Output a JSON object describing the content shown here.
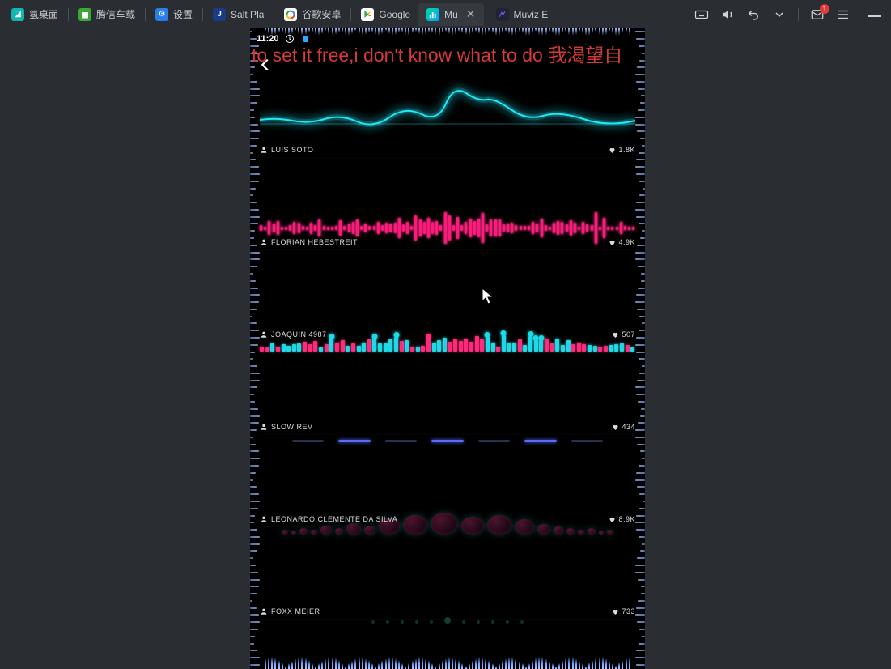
{
  "tabs": [
    {
      "label": "氢桌面",
      "iconClass": "teal"
    },
    {
      "label": "腾信车载",
      "iconClass": "green"
    },
    {
      "label": "设置",
      "iconClass": "blue"
    },
    {
      "label": "Salt Pla",
      "iconClass": "darkblue"
    },
    {
      "label": "谷歌安卓",
      "iconClass": "google"
    },
    {
      "label": "Google",
      "iconClass": "play"
    },
    {
      "label": "Mu",
      "iconClass": "app",
      "active": true,
      "closable": true
    },
    {
      "label": "Muviz E",
      "iconClass": "dark"
    }
  ],
  "tray": {
    "mailBadge": "1"
  },
  "status": {
    "time": "11:20"
  },
  "lyric": "to set it free,i don't know what to do 我渴望自",
  "items": [
    {
      "author": "LUIS SOTO",
      "likes": "1.8K"
    },
    {
      "author": "FLORIAN HEBESTREIT",
      "likes": "4.9K"
    },
    {
      "author": "JOAQUIN 4987",
      "likes": "507"
    },
    {
      "author": "SLOW REV",
      "likes": "434"
    },
    {
      "author": "LEONARDO CLEMENTE DA SILVA",
      "likes": "8.9K"
    },
    {
      "author": "FOXX MEIER",
      "likes": "733"
    }
  ]
}
